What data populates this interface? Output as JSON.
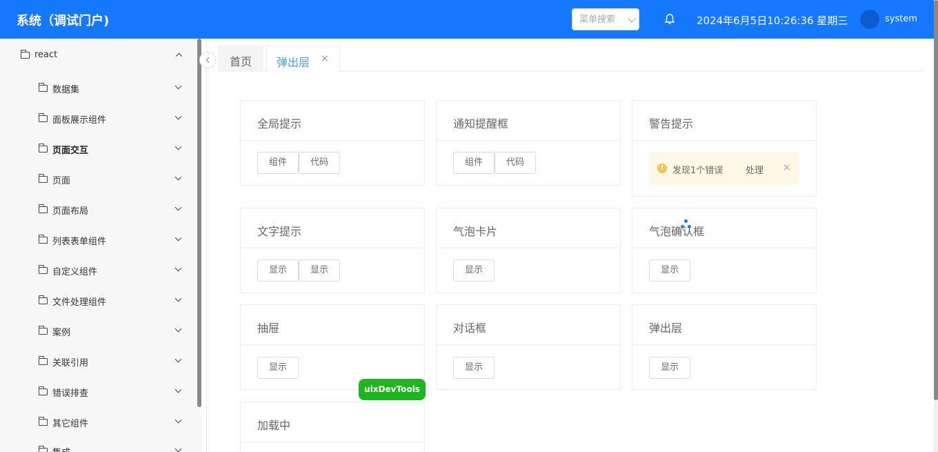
{
  "header": {
    "title": "系统（调试门户)",
    "search_placeholder": "菜单搜索",
    "datetime": "2024年6月5日10:26:36 星期三",
    "username": "system"
  },
  "sidebar": {
    "root": {
      "label": "react"
    },
    "items": [
      {
        "label": "数据集"
      },
      {
        "label": "面板展示组件"
      },
      {
        "label": "页面交互"
      },
      {
        "label": "页面"
      },
      {
        "label": "页面布局"
      },
      {
        "label": "列表表单组件"
      },
      {
        "label": "自定义组件"
      },
      {
        "label": "文件处理组件"
      },
      {
        "label": "案例"
      },
      {
        "label": "关联引用"
      },
      {
        "label": "错误排查"
      },
      {
        "label": "其它组件"
      },
      {
        "label": "集成"
      }
    ]
  },
  "tabs": {
    "home": "首页",
    "active": "弹出层",
    "close": "×"
  },
  "cards": {
    "global_tip": {
      "title": "全局提示",
      "btn1": "组件",
      "btn2": "代码"
    },
    "notification": {
      "title": "通知提醒框",
      "btn1": "组件",
      "btn2": "代码"
    },
    "warning": {
      "title": "警告提示",
      "icon": "!",
      "message": "发现1个错误",
      "action": "处理",
      "close": "×"
    },
    "tooltip": {
      "title": "文字提示",
      "btn1": "显示",
      "btn2": "显示"
    },
    "popover": {
      "title": "气泡卡片",
      "btn1": "显示"
    },
    "popconfirm": {
      "title": "气泡确认框",
      "btn1": "显示"
    },
    "drawer": {
      "title": "抽屉",
      "btn1": "显示"
    },
    "dialog": {
      "title": "对话框",
      "btn1": "显示"
    },
    "popup": {
      "title": "弹出层",
      "btn1": "显示"
    },
    "loading": {
      "title": "加载中"
    }
  },
  "devtools_label": "uixDevTools",
  "colors": {
    "primary": "#1677ff",
    "devtools": "#1fb520",
    "warning": "#f7c15a"
  }
}
